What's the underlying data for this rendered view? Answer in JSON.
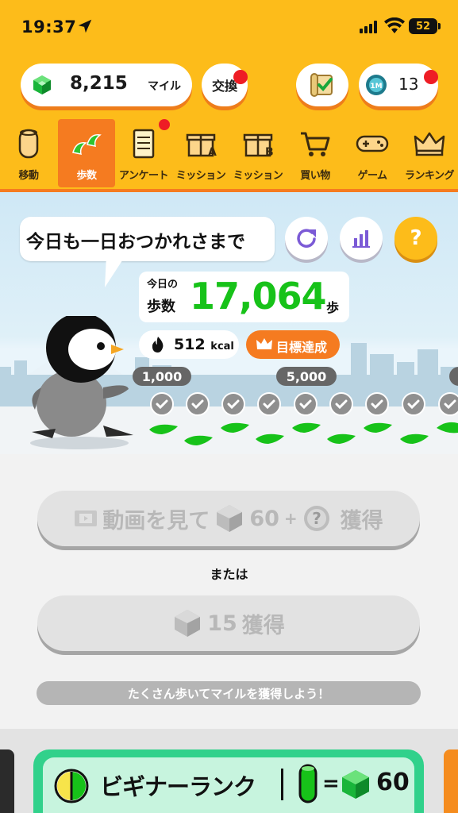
{
  "status_bar": {
    "time": "19:37",
    "battery": "52"
  },
  "header": {
    "miles_value": "8,215",
    "miles_unit": "マイル",
    "exchange_label": "交換",
    "ticket_count": "13"
  },
  "nav": {
    "items": [
      {
        "label": "移動",
        "icon": "tube-icon"
      },
      {
        "label": "歩数",
        "icon": "footprints-icon",
        "active": true
      },
      {
        "label": "アンケート",
        "icon": "clipboard-icon"
      },
      {
        "label": "ミッション",
        "icon": "gift-a-icon"
      },
      {
        "label": "ミッション",
        "icon": "gift-b-icon"
      },
      {
        "label": "買い物",
        "icon": "cart-icon"
      },
      {
        "label": "ゲーム",
        "icon": "gamepad-icon"
      },
      {
        "label": "ランキング",
        "icon": "crown-icon"
      }
    ]
  },
  "scene": {
    "speech": "今日も一日おつかれさまで",
    "steps_caption_line1": "今日の",
    "steps_caption_line2": "歩数",
    "steps_value": "17,064",
    "steps_unit": "歩",
    "kcal_value": "512",
    "kcal_unit": "kcal",
    "goal_label": "目標達成",
    "milestones": [
      "1,000",
      "5,000"
    ]
  },
  "actions": {
    "watch_label": "動画を見て",
    "watch_amount": "60",
    "watch_plus": "+",
    "watch_suffix": "獲得",
    "or_label": "または",
    "earn_amount": "15",
    "earn_suffix": "獲得",
    "hint": "たくさん歩いてマイルを獲得しよう！"
  },
  "bottom": {
    "rank_label": "ビギナーランク",
    "rank_eq": "=",
    "rank_value": "60"
  },
  "colors": {
    "header_yellow": "#fdbc1a",
    "accent_orange": "#f57b20",
    "steps_green": "#17c219",
    "alert_red": "#ee1d25"
  }
}
